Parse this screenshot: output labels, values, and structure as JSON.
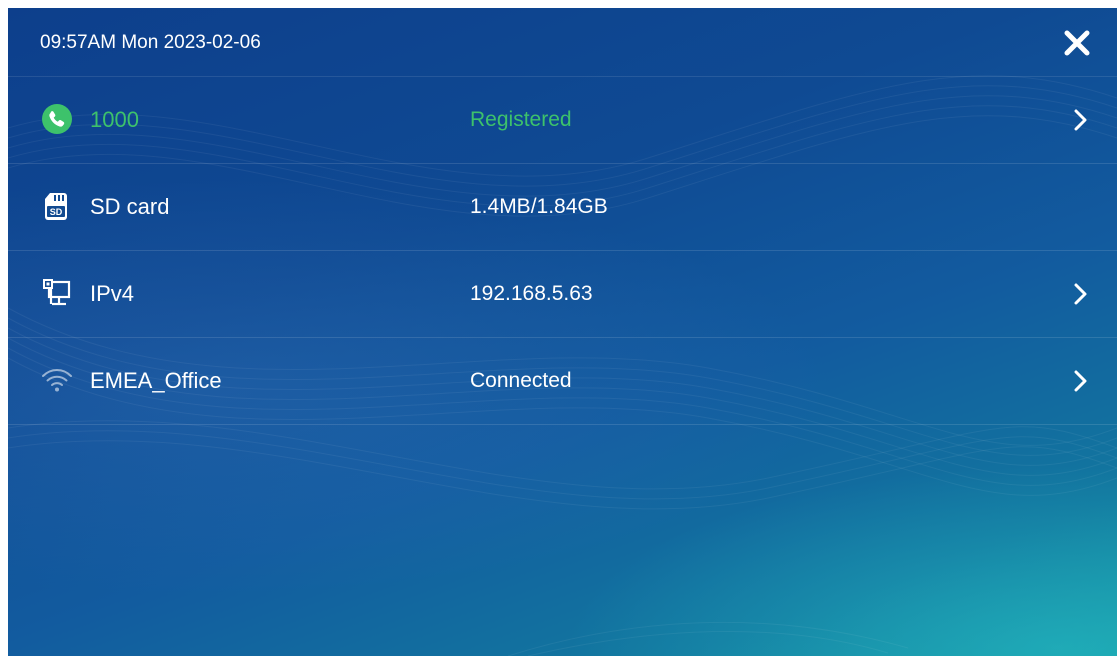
{
  "status_bar": {
    "datetime": "09:57AM Mon 2023-02-06"
  },
  "colors": {
    "registered_green": "#3dc26b",
    "text": "#ffffff",
    "background_top": "#0d3f8c",
    "background_bottom": "#1597a3"
  },
  "rows": [
    {
      "icon": "phone-icon",
      "label": "1000",
      "value": "Registered",
      "has_chevron": true
    },
    {
      "icon": "sd-card-icon",
      "label": "SD card",
      "value": "1.4MB/1.84GB",
      "has_chevron": false
    },
    {
      "icon": "network-icon",
      "label": "IPv4",
      "value": "192.168.5.63",
      "has_chevron": true
    },
    {
      "icon": "wifi-icon",
      "label": "EMEA_Office",
      "value": "Connected",
      "has_chevron": true
    }
  ],
  "close_icon": "close-icon"
}
